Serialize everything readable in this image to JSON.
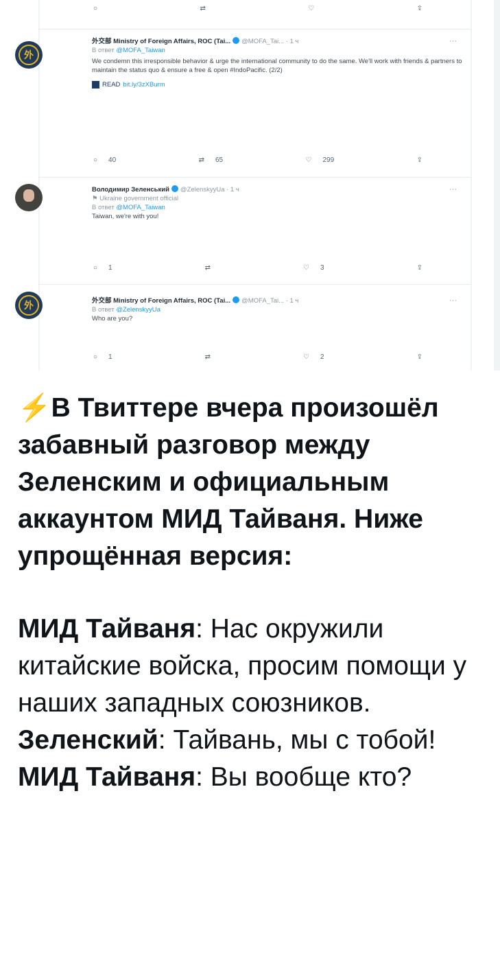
{
  "screenshot": {
    "top_actions": {
      "reply": "○",
      "retweet": "⇄",
      "like": "♡",
      "share": "⇪"
    },
    "tweets": [
      {
        "author": "外交部 Ministry of Foreign Affairs, ROC (Tai...",
        "handle": "@MOFA_Tai... · 1 ч",
        "reply_to_prefix": "В ответ",
        "reply_to": "@MOFA_Taiwan",
        "text": "We condemn this irresponsible behavior & urge the international community to do the same. We'll work with friends & partners to maintain the status quo & ensure a free & open #IndoPacific. (2/2)",
        "read_label": "READ",
        "read_link": "bit.ly/3zXBurm",
        "replies": "40",
        "retweets": "65",
        "likes": "299"
      },
      {
        "author": "Володимир Зеленський",
        "handle": "@ZelenskyyUa · 1 ч",
        "label": "Ukraine government official",
        "reply_to_prefix": "В ответ",
        "reply_to": "@MOFA_Taiwan",
        "text": "Taiwan, we're with you!",
        "replies": "1",
        "retweets": "",
        "likes": "3"
      },
      {
        "author": "外交部 Ministry of Foreign Affairs, ROC (Tai...",
        "handle": "@MOFA_Tai... · 1 ч",
        "reply_to_prefix": "В ответ",
        "reply_to": "@ZelenskyyUa",
        "text": "Who are you?",
        "replies": "1",
        "retweets": "",
        "likes": "2"
      }
    ],
    "more_label": "···"
  },
  "caption": {
    "intro": "В Твиттере вчера произошёл забавный разговор между Зеленским и официальным аккаунтом МИД Тайваня. Ниже упрощённая версия:",
    "lines": [
      {
        "speaker": "МИД Тайваня",
        "text": ": Нас окружили китайские войска, просим помощи у наших западных союзников."
      },
      {
        "speaker": "Зеленский",
        "text": ": Тайвань, мы с тобой!"
      },
      {
        "speaker": "МИД Тайваня",
        "text": ": Вы вообще кто?"
      }
    ]
  }
}
